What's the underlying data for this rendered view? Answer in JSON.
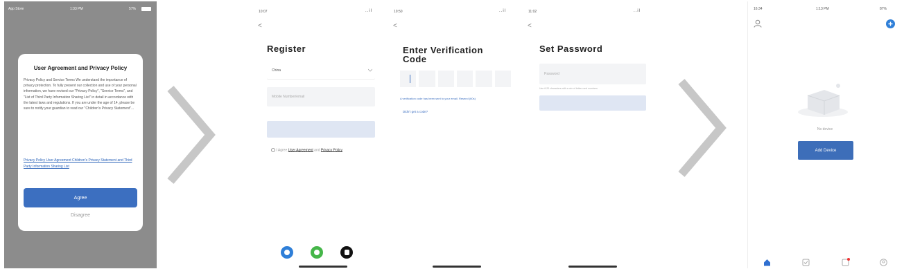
{
  "screen1": {
    "status": {
      "carrier": "App Store",
      "time": "1:33 PM",
      "battery": "57%"
    },
    "dialog": {
      "title": "User Agreement and Privacy Policy",
      "body": "Privacy Policy and Service Terms We understand the importance of privacy protection. To fully present our collection and use of your personal information, we have revised our \"Privacy Policy\", \"Service Terms\", and \"List of Third Party Information Sharing List\" in detail in accordance with the latest laws and regulations. If you are under the age of 14, please be sure to notify your guardian to read our \"Children's Privacy Statement\"...",
      "links": "Privacy Policy User Agreement Children's Privacy Statement and Third Party Information Sharing List",
      "agree": "Agree",
      "disagree": "Disagree"
    }
  },
  "screen2": {
    "status": {
      "time": "10:07",
      "signal": "..il"
    },
    "back": "<",
    "title": "Register",
    "region": "China",
    "phone_placeholder": "Mobile Number/email",
    "agreement_prefix": "I Agree",
    "user_agreement": "User Agreement",
    "and": "and",
    "privacy_policy": "Privacy Policy"
  },
  "screen3": {
    "status": {
      "time": "10:50",
      "signal": "..il"
    },
    "back": "<",
    "title_line1": "Enter Verification",
    "title_line2": "Code",
    "hint": "A verification code has been sent to your email. Resend (60s)",
    "no_code": "Didn't get a code?"
  },
  "screen4": {
    "status": {
      "time": "11:02",
      "signal": "..il"
    },
    "back": "<",
    "title": "Set Password",
    "password_placeholder": "Password",
    "hint": "Use 6-20 characters with a mix of letters and numbers"
  },
  "screen6": {
    "status": {
      "carrier": "16:34",
      "time": "1:13 PM",
      "battery": "87%"
    },
    "empty_text": "No device",
    "add_device": "Add Device"
  },
  "colors": {
    "primary": "#3c6fc0",
    "overlay": "#8c8c8c",
    "chevron": "#c7c7c7",
    "icon_blue": "#2f7fd8",
    "icon_green": "#45b649"
  },
  "icons": [
    "user-icon",
    "add-circle-icon",
    "home-icon",
    "scene-icon",
    "smart-icon",
    "profile-icon",
    "chevron-right-icon"
  ]
}
